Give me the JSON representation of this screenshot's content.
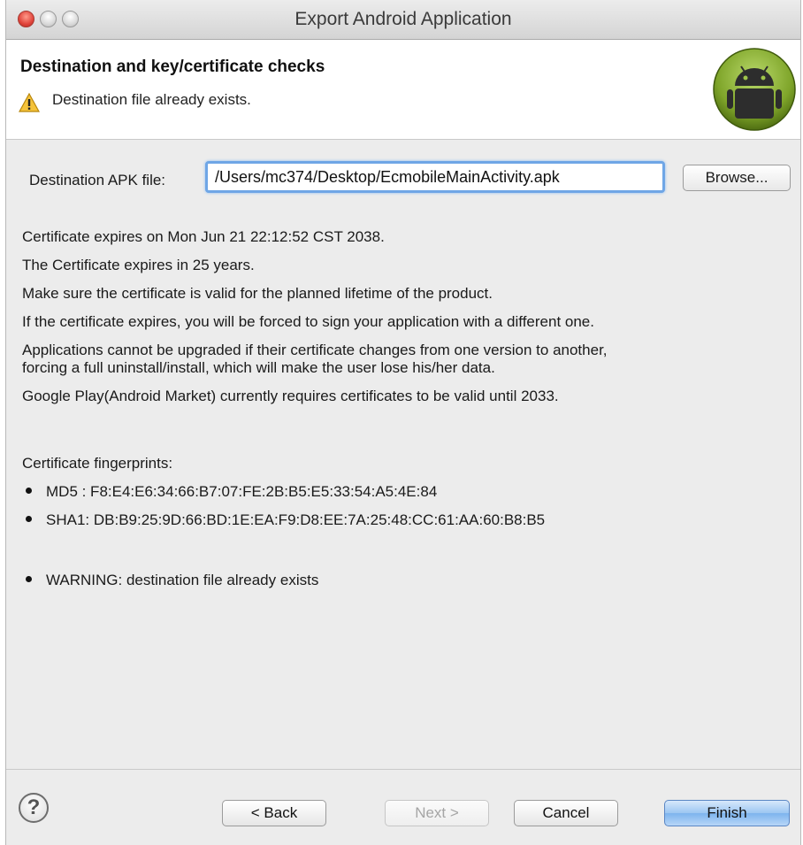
{
  "window": {
    "title": "Export Android Application"
  },
  "header": {
    "title": "Destination and key/certificate checks",
    "message": "Destination file already exists."
  },
  "destination": {
    "label": "Destination APK file:",
    "value": "/Users/mc374/Desktop/EcmobileMainActivity.apk",
    "browse_label": "Browse..."
  },
  "info": {
    "line1": "Certificate expires on Mon Jun 21 22:12:52 CST 2038.",
    "line2": "The Certificate expires in 25 years.",
    "line3": "Make sure the certificate is valid for the planned lifetime of the product.",
    "line4": "If the certificate expires, you will be forced to sign your application with a different one.",
    "line5a": "Applications cannot be upgraded if their certificate changes from one version to another,",
    "line5b": "forcing a full uninstall/install, which will make the user lose his/her data.",
    "line6": "Google Play(Android Market) currently requires certificates to be valid until 2033."
  },
  "fingerprints": {
    "heading": "Certificate fingerprints:",
    "md5": "MD5 : F8:E4:E6:34:66:B7:07:FE:2B:B5:E5:33:54:A5:4E:84",
    "sha1": "SHA1: DB:B9:25:9D:66:BD:1E:EA:F9:D8:EE:7A:25:48:CC:61:AA:60:B8:B5"
  },
  "warning": "WARNING: destination file already exists",
  "footer": {
    "help": "?",
    "back": "< Back",
    "next": "Next >",
    "cancel": "Cancel",
    "finish": "Finish"
  }
}
